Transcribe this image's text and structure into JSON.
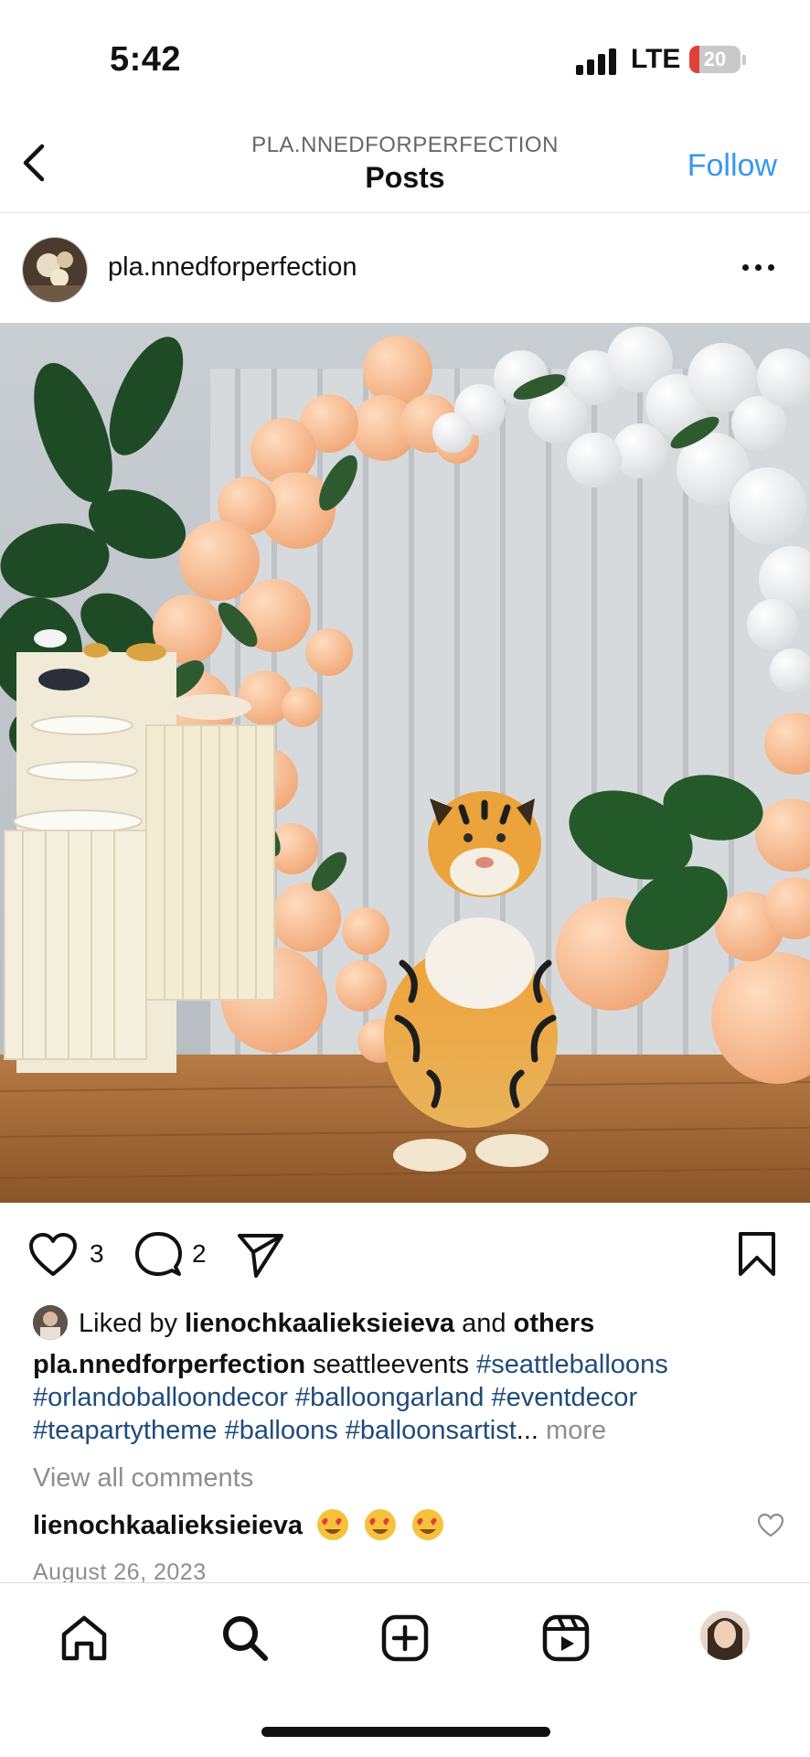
{
  "status": {
    "time": "5:42",
    "network": "LTE",
    "battery": "20",
    "battery_level": 0.2
  },
  "header": {
    "subtitle": "PLA.NNEDFORPERFECTION",
    "title": "Posts",
    "follow_label": "Follow"
  },
  "post": {
    "username": "pla.nnedforperfection",
    "like_count": "3",
    "comment_count": "2",
    "liked_by": {
      "prefix": "Liked by",
      "user": "lienochkaalieksieieva",
      "conj": "and",
      "others": "others"
    },
    "caption": {
      "user": "pla.nnedforperfection",
      "text": "seattleevents",
      "tags_line1": [
        "#seattleballoons"
      ],
      "tags_line2": [
        "#orlandoballoondecor",
        "#balloongarland",
        "#eventdecor"
      ],
      "tags_line3": [
        "#teapartytheme",
        "#balloons",
        "#balloonsartist"
      ],
      "ellipsis": "...",
      "more": "more"
    },
    "view_all_comments": "View all comments",
    "comment": {
      "user": "lienochkaalieksieieva",
      "emoji_count": 3
    },
    "date": "August 26, 2023"
  },
  "tabbar": {
    "tabs": [
      "home-icon",
      "search-icon",
      "create-icon",
      "reels-icon",
      "profile-avatar"
    ]
  }
}
